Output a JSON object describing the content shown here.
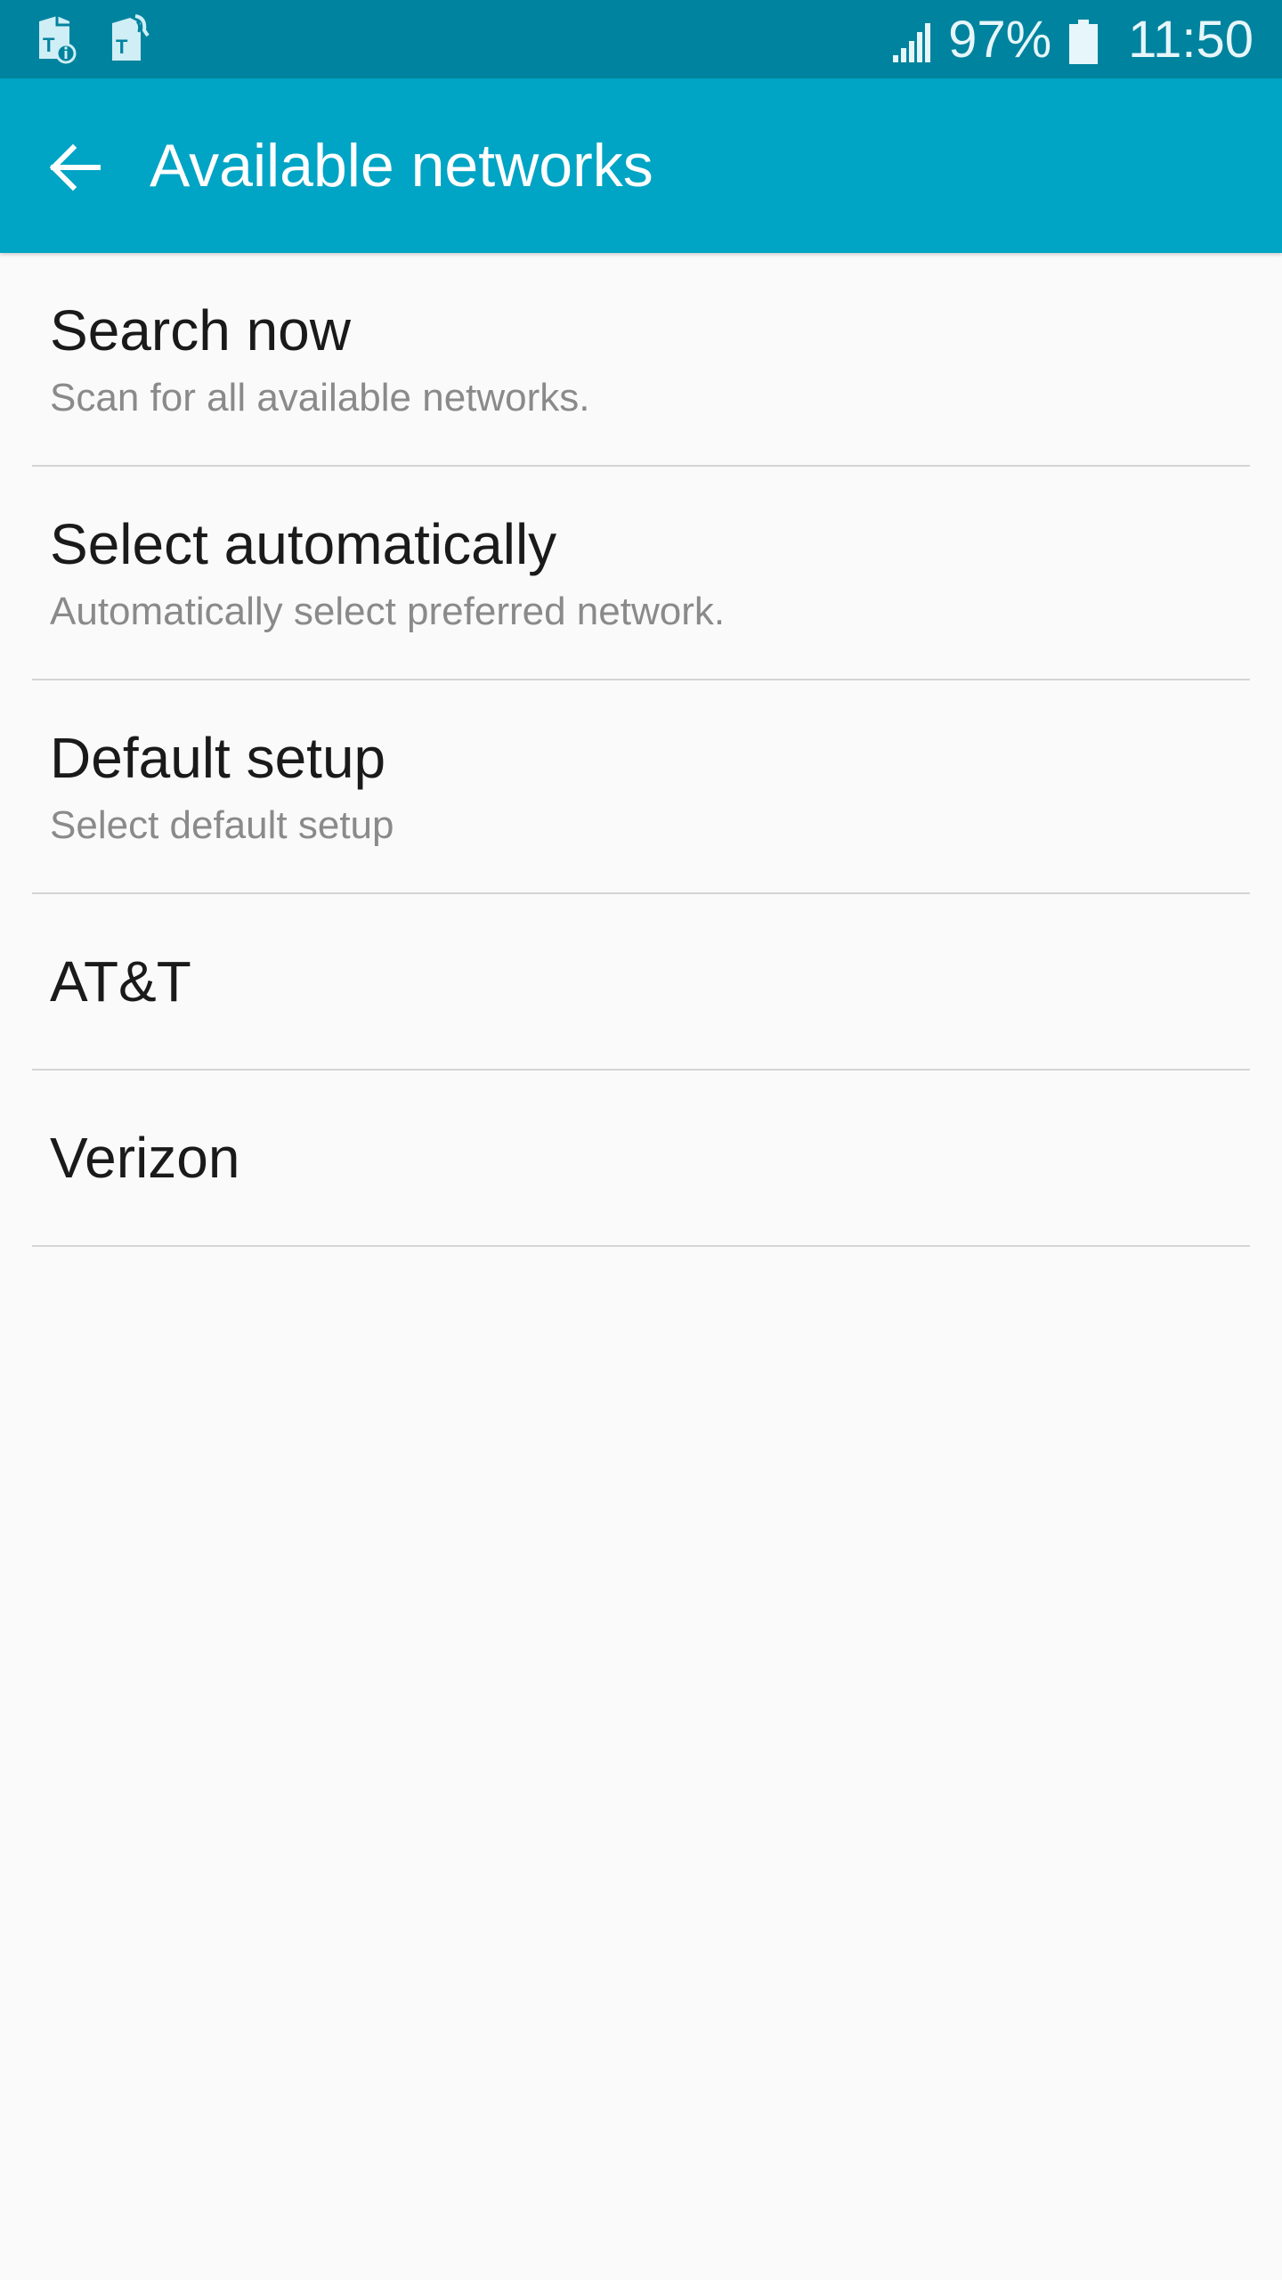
{
  "status_bar": {
    "notification_icons": [
      "sim-card-info-icon",
      "sim-card-alert-icon"
    ],
    "signal_icon": "cellular-signal-icon",
    "battery_percent": "97%",
    "battery_icon": "battery-icon",
    "time": "11:50"
  },
  "app_bar": {
    "back_icon": "back-arrow-icon",
    "title": "Available networks",
    "color": "#00a4c4"
  },
  "list": {
    "items": [
      {
        "title": "Search now",
        "subtitle": "Scan for all available networks."
      },
      {
        "title": "Select automatically",
        "subtitle": "Automatically select preferred network."
      },
      {
        "title": "Default setup",
        "subtitle": "Select default setup"
      },
      {
        "title": "AT&T"
      },
      {
        "title": "Verizon"
      }
    ]
  },
  "colors": {
    "status_bar": "#00839e",
    "app_bar": "#00a4c4",
    "background": "#fafafa",
    "divider": "#d4d4d4",
    "title_text": "#1a1a1a",
    "subtitle_text": "#8a8a8a"
  }
}
